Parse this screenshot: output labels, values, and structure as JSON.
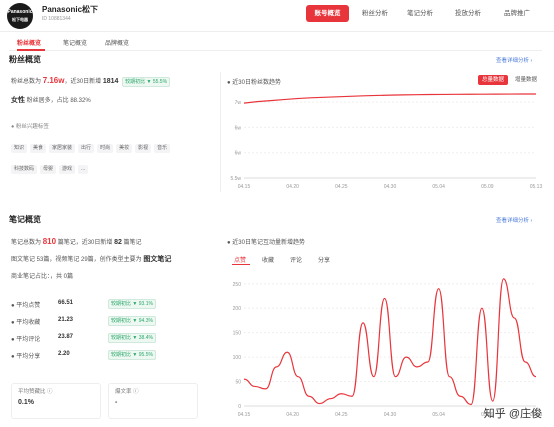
{
  "header": {
    "logo_text": "Panasonic\n松下电器",
    "brand_name": "Panasonic松下",
    "brand_id": "ID 10881344",
    "nav": [
      {
        "label": "账号概览",
        "active": true
      },
      {
        "label": "粉丝分析",
        "active": false
      },
      {
        "label": "笔记分析",
        "active": false
      },
      {
        "label": "投放分析",
        "active": false
      },
      {
        "label": "品牌推广",
        "active": false
      }
    ]
  },
  "subtabs": [
    {
      "label": "粉丝概览",
      "active": true
    },
    {
      "label": "笔记概览",
      "active": false
    },
    {
      "label": "品牌概览",
      "active": false
    }
  ],
  "fans": {
    "title": "粉丝概览",
    "detail_link": "查看详细分析 ›",
    "total_label": "粉丝总数为",
    "total_value": "7.16w",
    "new_label": "，近30日新增",
    "new_value": "1814",
    "ring_label": "较期初比",
    "ring_value": "▼ 55.5%",
    "gender_label": "女性",
    "gender_rest": "粉丝居多，占比 88.32%",
    "interest_title": "粉丝兴趣标签",
    "tags": [
      "知识",
      "美食",
      "家居家装",
      "出行",
      "时尚",
      "美妆",
      "影视",
      "音乐",
      "科技数码",
      "母婴",
      "游戏",
      "..."
    ],
    "trend_title": "近30日粉丝数趋势",
    "trend_btn_active": "总量数据",
    "trend_btn_plain": "增量数据"
  },
  "notes": {
    "title": "笔记概览",
    "detail_link": "查看详细分析 ›",
    "line1": "笔记总数为",
    "line1_val": "810",
    "line1_rest": "篇笔记，近30日新增",
    "line1_val2": "82",
    "line1_rest2": "篇笔记",
    "line2": "图文笔记 53篇，视频笔记 29篇，创作类型主要为",
    "line2_val": "图文笔记",
    "line3": "商业笔记占比：，共 0篇",
    "stats": [
      {
        "label": "平均点赞",
        "value": "66.51",
        "cmp_label": "较期初比",
        "cmp_value": "▼ 93.1%"
      },
      {
        "label": "平均收藏",
        "value": "21.23",
        "cmp_label": "较期初比",
        "cmp_value": "▼ 94.3%"
      },
      {
        "label": "平均评论",
        "value": "23.87",
        "cmp_label": "较期初比",
        "cmp_value": "▼ 38.4%"
      },
      {
        "label": "平均分享",
        "value": "2.20",
        "cmp_label": "较期初比",
        "cmp_value": "▼ 95.5%"
      }
    ],
    "card1_label": "平均赞藏比 ⓘ",
    "card1_value": "0.1%",
    "card2_label": "爆文率 ⓘ",
    "card2_value": "-",
    "interaction_title": "近30日笔记互动量新增趋势",
    "interaction_tabs": [
      "点赞",
      "收藏",
      "评论",
      "分享"
    ]
  },
  "watermark": "知乎 @庄俊",
  "colors": {
    "accent": "#e8353b",
    "green": "#2aa86a",
    "link": "#4a7bd9"
  },
  "chart_data": [
    {
      "type": "line",
      "title": "近30日粉丝数趋势",
      "x": [
        "04.15",
        "04.20",
        "04.25",
        "04.30",
        "05.04",
        "05.09",
        "05.13"
      ],
      "ytick_labels": [
        "7w",
        "6w",
        "6w",
        "5.5w"
      ],
      "yticks": [
        70000,
        65000,
        60000,
        55000
      ],
      "ylim": [
        55000,
        72000
      ],
      "values": [
        69800,
        70100,
        70300,
        70500,
        70700,
        70850,
        70950,
        71050,
        71150,
        71250,
        71320,
        71380,
        71430,
        71470,
        71500,
        71520,
        71540,
        71560,
        71570,
        71580,
        71590,
        71600,
        71600
      ]
    },
    {
      "type": "line",
      "title": "近30日笔记互动量新增趋势",
      "x": [
        "04.15",
        "04.20",
        "04.25",
        "04.30",
        "05.04",
        "05.09",
        "05.13"
      ],
      "yticks": [
        0,
        50,
        100,
        150,
        200,
        250
      ],
      "ylim": [
        0,
        270
      ],
      "values": [
        55,
        40,
        35,
        80,
        110,
        60,
        20,
        5,
        15,
        25,
        20,
        170,
        60,
        220,
        60,
        100,
        80,
        90,
        240,
        60,
        20,
        3,
        200,
        10,
        260,
        180,
        90,
        60
      ]
    }
  ]
}
